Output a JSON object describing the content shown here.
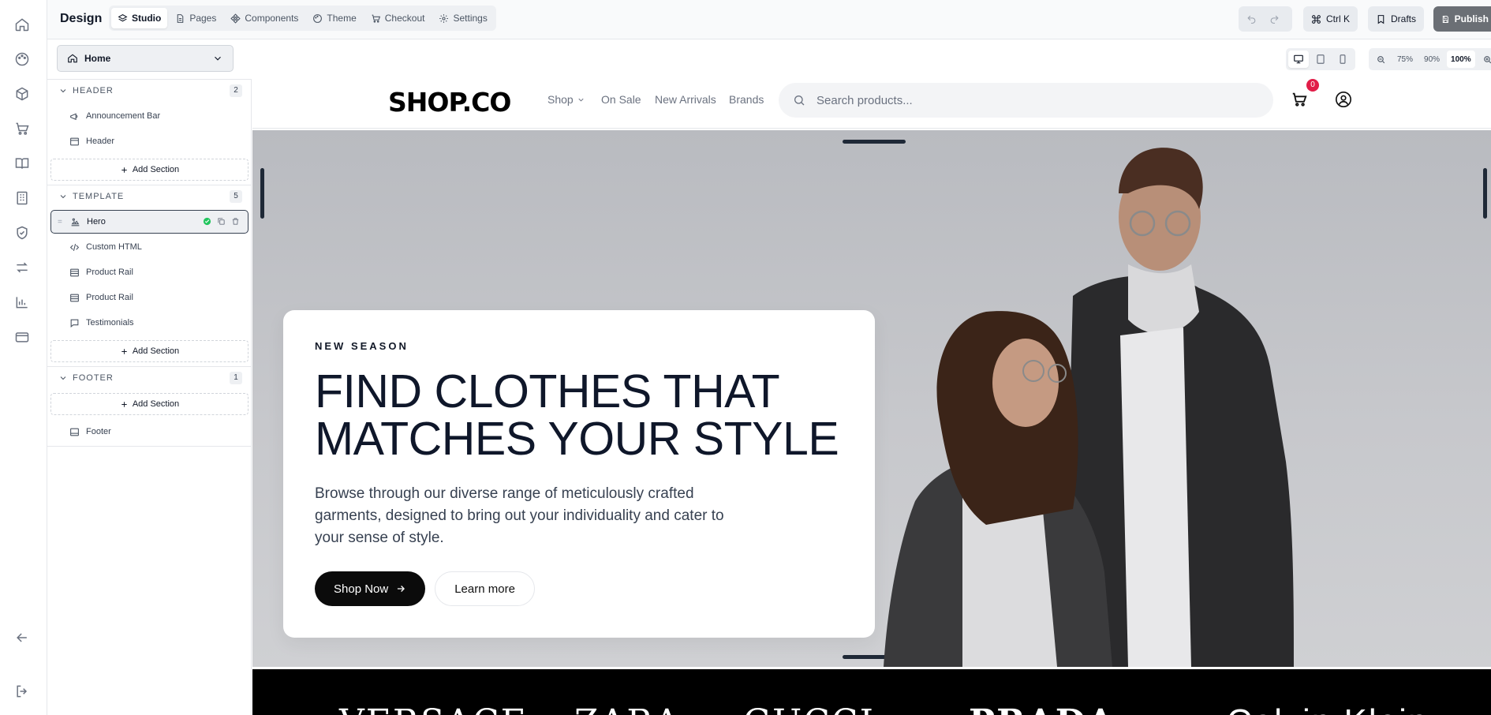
{
  "topbar": {
    "brand": "Design",
    "tabs": [
      {
        "label": "Studio",
        "icon": "layers-icon",
        "active": true
      },
      {
        "label": "Pages",
        "icon": "file-icon"
      },
      {
        "label": "Components",
        "icon": "components-icon"
      },
      {
        "label": "Theme",
        "icon": "palette-icon"
      },
      {
        "label": "Checkout",
        "icon": "cart-icon"
      },
      {
        "label": "Settings",
        "icon": "gear-icon"
      }
    ],
    "shortcut_label": "Ctrl K",
    "drafts_label": "Drafts",
    "publish_label": "Publish"
  },
  "page_selector": {
    "value": "Home"
  },
  "zoom": {
    "options": [
      "75%",
      "90%",
      "100%"
    ],
    "selected": "100%"
  },
  "tree": {
    "groups": [
      {
        "label": "HEADER",
        "count": "2",
        "items": [
          "Announcement Bar",
          "Header"
        ]
      },
      {
        "label": "TEMPLATE",
        "count": "5",
        "items": [
          "Hero",
          "Custom HTML",
          "Product Rail",
          "Product Rail",
          "Testimonials"
        ]
      },
      {
        "label": "FOOTER",
        "count": "1",
        "items": [
          "Footer"
        ]
      }
    ],
    "add_section_label": "Add Section",
    "selected_item": "Hero"
  },
  "store": {
    "logo": "SHOP.CO",
    "nav": [
      "Shop",
      "On Sale",
      "New Arrivals",
      "Brands"
    ],
    "search_placeholder": "Search products...",
    "cart_count": "0"
  },
  "hero": {
    "kicker": "NEW SEASON",
    "title_line1": "FIND CLOTHES THAT",
    "title_line2": "MATCHES YOUR STYLE",
    "description": "Browse through our diverse range of meticulously crafted garments, designed to bring out your individuality and cater to your sense of style.",
    "primary_cta": "Shop Now",
    "secondary_cta": "Learn more"
  },
  "brand_strip": [
    "VERSACE",
    "ZARA",
    "GUCCI",
    "PRADA",
    "Calvin Klein"
  ],
  "colors": {
    "accent": "#111827",
    "badge": "#e11d48",
    "success": "#22c55e",
    "hero_bg": "#c3c4c8"
  }
}
